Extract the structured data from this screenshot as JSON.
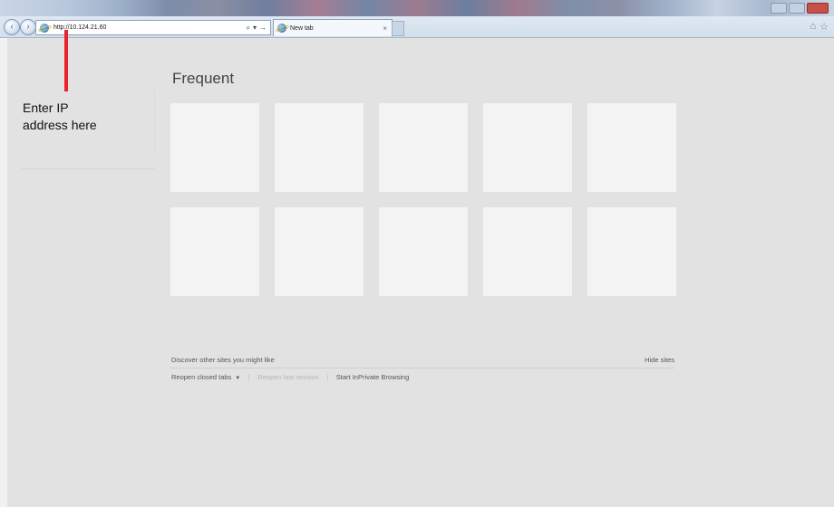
{
  "browser": {
    "address_url": "http://10.124.21.60",
    "tab_title": "New tab",
    "tab_close": "×",
    "back_glyph": "‹",
    "forward_glyph": "›",
    "search_glyph": "⌕",
    "dropdown_glyph": "▾",
    "go_glyph": "→",
    "home_glyph": "⌂",
    "favorites_glyph": "☆"
  },
  "annotation": {
    "text_line1": "Enter IP",
    "text_line2": "address here",
    "color": "#e8232b"
  },
  "main": {
    "title": "Frequent",
    "tile_count": 10,
    "discover_text": "Discover other sites you might like",
    "hide_sites": "Hide sites",
    "reopen_closed_tabs": "Reopen closed tabs",
    "reopen_closed_caret": "▼",
    "reopen_last_session": "Reopen last session",
    "start_inprivate": "Start InPrivate Browsing"
  }
}
